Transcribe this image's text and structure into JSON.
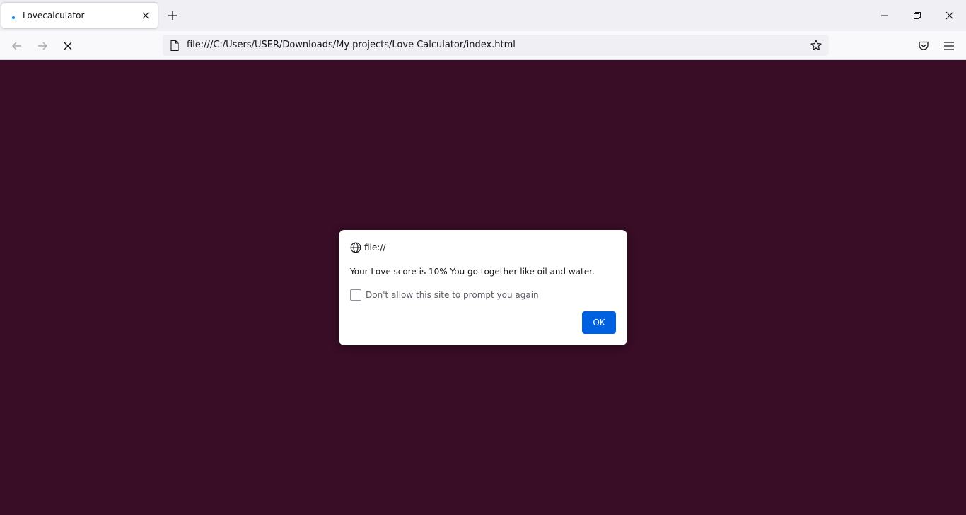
{
  "browser": {
    "tab": {
      "title": "Lovecalculator"
    },
    "url": "file:///C:/Users/USER/Downloads/My projects/Love Calculator/index.html"
  },
  "page": {
    "background_color": "#380d25"
  },
  "dialog": {
    "origin": "file://",
    "message": "Your Love score is 10% You go together like oil and water.",
    "checkbox_label": "Don't allow this site to prompt you again",
    "ok_label": "OK"
  },
  "icons": {
    "tab_dot": "loading-dot-icon",
    "tab_close": "close-icon",
    "new_tab": "plus-icon",
    "minimize": "minimize-icon",
    "restore": "restore-icon",
    "window_close": "close-icon",
    "back": "back-arrow-icon",
    "forward": "forward-arrow-icon",
    "stop": "stop-icon",
    "page": "page-icon",
    "bookmark": "star-icon",
    "pocket": "pocket-icon",
    "menu": "hamburger-menu-icon",
    "globe": "globe-icon"
  },
  "colors": {
    "accent_button": "#0061e0",
    "tab_loading_dot": "#0a84ff"
  }
}
